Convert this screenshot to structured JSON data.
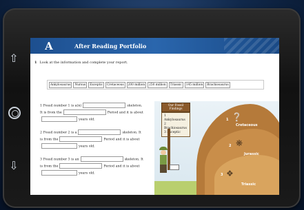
{
  "header": {
    "letter": "A",
    "title": "After Reading Portfolio"
  },
  "instruction": {
    "number": "1",
    "text": "Look at the information and complete your report."
  },
  "word_bank": [
    "Ankylosaurus",
    "Nursus",
    "Exceptic",
    "Cretaceous",
    "200 million",
    "250 million",
    "Triassic",
    "145 million",
    "Brachiosaurus"
  ],
  "questions": [
    {
      "l1a": "1 Fossil number 1 is a(n)",
      "l1b": "skeleton.",
      "l2a": "It is from the",
      "l2b": "Period and it is about",
      "l3": "years old."
    },
    {
      "l1a": "2 Fossil number 2 is a",
      "l1b": "skeleton. It",
      "l2a": "is from the",
      "l2b": "Period and it is about",
      "l3": "years old."
    },
    {
      "l1a": "3 Fossil number 3 is an",
      "l1b": "skeleton. It",
      "l2a": "is from the",
      "l2b": "Period and it is about",
      "l3": "years old."
    }
  ],
  "sign": {
    "title": "Our Fossil Findings",
    "items": [
      "1 Ankylosaurus",
      "2 Brachiosaurus",
      "3 Exceptic"
    ]
  },
  "layers": [
    "Cretaceous",
    "Jurassic",
    "Triassic"
  ],
  "fossil_numbers": [
    "1",
    "2",
    "3"
  ]
}
